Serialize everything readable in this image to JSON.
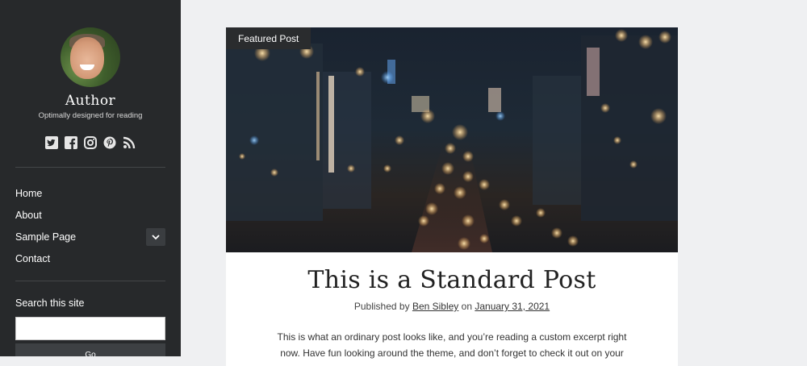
{
  "sidebar": {
    "author_name": "Author",
    "tagline": "Optimally designed for reading",
    "social_icons": [
      "twitter-icon",
      "facebook-icon",
      "instagram-icon",
      "pinterest-icon",
      "rss-icon"
    ],
    "nav_items": [
      {
        "label": "Home"
      },
      {
        "label": "About"
      },
      {
        "label": "Sample Page",
        "has_submenu": true
      },
      {
        "label": "Contact"
      }
    ],
    "search_label": "Search this site",
    "search_value": "",
    "search_button": "Go"
  },
  "post": {
    "badge": "Featured Post",
    "title": "This is a Standard Post",
    "byline_prefix": "Published by",
    "author_link": "Ben Sibley",
    "byline_middle": "on",
    "date_link": "January 31, 2021",
    "excerpt": "This is what an ordinary post looks like, and you’re reading a custom excerpt right now. Have fun looking around the theme, and don’t forget to check it out on your"
  },
  "colors": {
    "sidebar_bg": "#27292b",
    "page_bg": "#eff0f2",
    "badge_bg": "#2a2c2e"
  }
}
